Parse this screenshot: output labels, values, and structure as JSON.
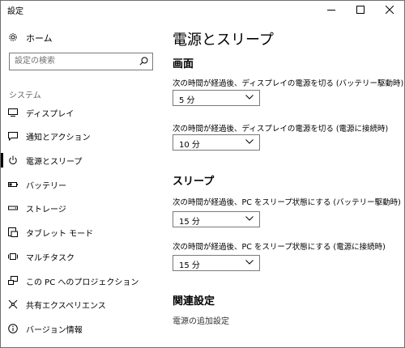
{
  "window": {
    "title": "設定"
  },
  "sidebar": {
    "home_label": "ホーム",
    "search_placeholder": "設定の検索",
    "section_label": "システム",
    "items": [
      {
        "label": "ディスプレイ",
        "icon": "monitor-icon"
      },
      {
        "label": "通知とアクション",
        "icon": "notification-icon"
      },
      {
        "label": "電源とスリープ",
        "icon": "power-icon",
        "selected": true
      },
      {
        "label": "バッテリー",
        "icon": "battery-icon"
      },
      {
        "label": "ストレージ",
        "icon": "storage-icon"
      },
      {
        "label": "タブレット モード",
        "icon": "tablet-mode-icon"
      },
      {
        "label": "マルチタスク",
        "icon": "multitask-icon"
      },
      {
        "label": "この PC へのプロジェクション",
        "icon": "projection-icon"
      },
      {
        "label": "共有エクスペリエンス",
        "icon": "shared-experience-icon"
      },
      {
        "label": "バージョン情報",
        "icon": "info-icon"
      }
    ]
  },
  "main": {
    "title": "電源とスリープ",
    "screen": {
      "heading": "画面",
      "battery_label": "次の時間が経過後、ディスプレイの電源を切る (バッテリー駆動時)",
      "battery_value": "5 分",
      "plugged_label": "次の時間が経過後、ディスプレイの電源を切る (電源に接続時)",
      "plugged_value": "10 分"
    },
    "sleep": {
      "heading": "スリープ",
      "battery_label": "次の時間が経過後、PC をスリープ状態にする (バッテリー駆動時)",
      "battery_value": "15 分",
      "plugged_label": "次の時間が経過後、PC をスリープ状態にする (電源に接続時)",
      "plugged_value": "15 分"
    },
    "related": {
      "heading": "関連設定",
      "link": "電源の追加設定"
    }
  }
}
